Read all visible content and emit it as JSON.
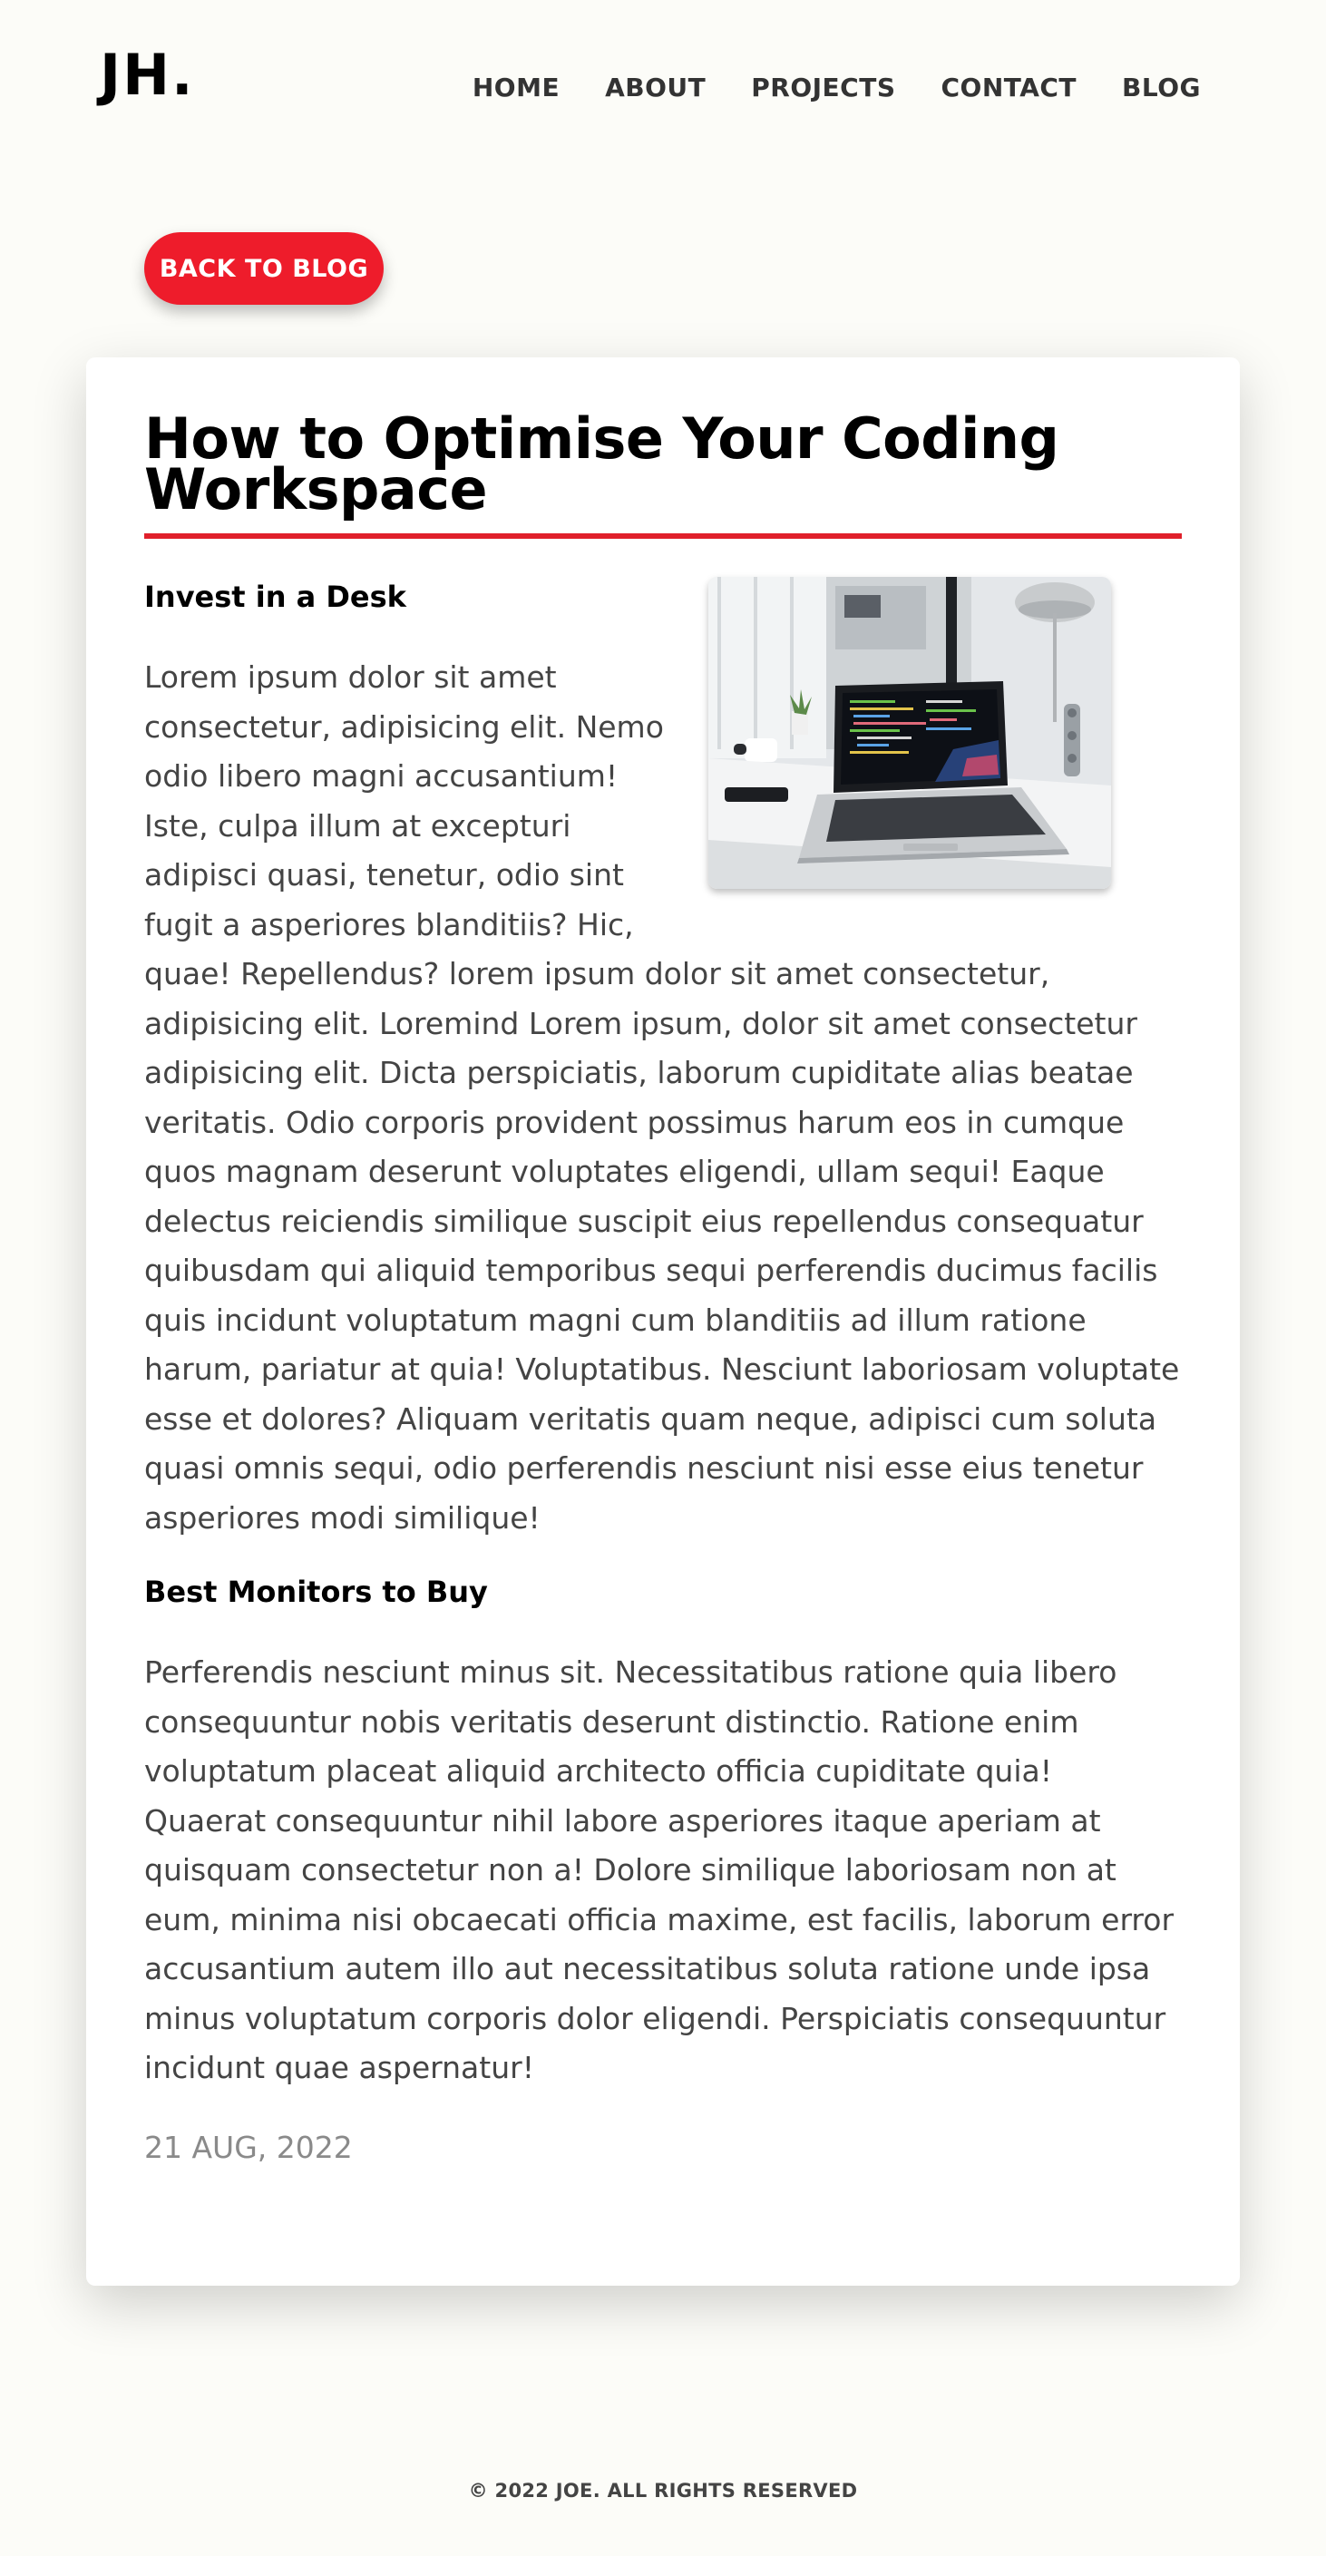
{
  "header": {
    "logo": "JH.",
    "nav": [
      "HOME",
      "ABOUT",
      "PROJECTS",
      "CONTACT",
      "BLOG"
    ]
  },
  "back_button": "BACK TO BLOG",
  "article": {
    "title": "How to Optimise Your Coding Workspace",
    "sections": [
      {
        "heading": "Invest in a Desk",
        "body": "Lorem ipsum dolor sit amet consectetur, adipisicing elit. Nemo odio libero magni accusantium! Iste, culpa illum at excepturi adipisci quasi, tenetur, odio sint fugit a asperiores blanditiis? Hic, quae! Repellendus? lorem ipsum dolor sit amet consectetur, adipisicing elit. Loremind Lorem ipsum, dolor sit amet consectetur adipisicing elit. Dicta perspiciatis, laborum cupiditate alias beatae veritatis. Odio corporis provident possimus harum eos in cumque quos magnam deserunt voluptates eligendi, ullam sequi! Eaque delectus reiciendis similique suscipit eius repellendus consequatur quibusdam qui aliquid temporibus sequi perferendis ducimus facilis quis incidunt voluptatum magni cum blanditiis ad illum ratione harum, pariatur at quia! Voluptatibus. Nesciunt laboriosam voluptate esse et dolores? Aliquam veritatis quam neque, adipisci cum soluta quasi omnis sequi, odio perferendis nesciunt nisi esse eius tenetur asperiores modi similique!"
      },
      {
        "heading": "Best Monitors to Buy",
        "body": "Perferendis nesciunt minus sit. Necessitatibus ratione quia libero consequuntur nobis veritatis deserunt distinctio. Ratione enim voluptatum placeat aliquid architecto officia cupiditate quia! Quaerat consequuntur nihil labore asperiores itaque aperiam at quisquam consectetur non a! Dolore similique laboriosam non at eum, minima nisi obcaecati officia maxime, est facilis, laborum error accusantium autem illo aut necessitatibus soluta ratione unde ipsa minus voluptatum corporis dolor eligendi. Perspiciatis consequuntur incidunt quae aspernatur!"
      }
    ],
    "date": "21 AUG, 2022"
  },
  "footer": "© 2022 JOE. ALL RIGHTS RESERVED",
  "colors": {
    "accent": "#ee1c2b",
    "background": "#fcfcf8"
  }
}
